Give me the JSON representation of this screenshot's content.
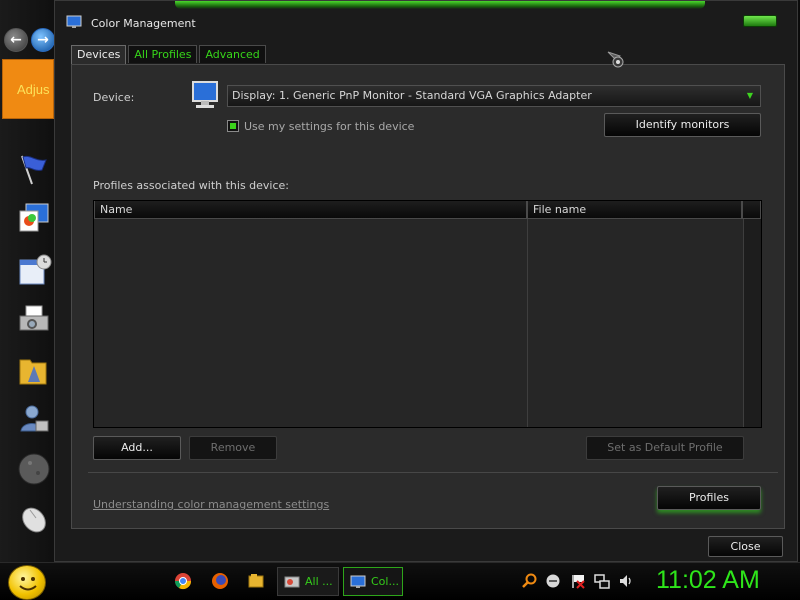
{
  "side_panel": {
    "back_glyph": "←",
    "forward_glyph": "→",
    "tile_text": "Adjus",
    "icons": [
      "flag-icon",
      "display-icon",
      "calendar-icon",
      "printer-icon",
      "folder-icon",
      "user-icon",
      "disc-icon",
      "mouse-icon"
    ]
  },
  "window": {
    "title": "Color Management",
    "tabs": [
      {
        "label": "Devices",
        "active": true
      },
      {
        "label": "All Profiles",
        "active": false
      },
      {
        "label": "Advanced",
        "active": false
      }
    ],
    "device": {
      "label": "Device:",
      "selected": "Display: 1. Generic PnP Monitor - Standard VGA Graphics Adapter",
      "use_my_settings_label": "Use my settings for this device",
      "use_my_settings_checked": true,
      "identify_button": "Identify monitors"
    },
    "profiles": {
      "label": "Profiles associated with this device:",
      "columns": [
        "Name",
        "File name"
      ],
      "rows": []
    },
    "buttons": {
      "add": "Add...",
      "remove": "Remove",
      "set_default": "Set as Default Profile",
      "profiles": "Profiles",
      "close": "Close"
    },
    "link_text": "Understanding color management settings"
  },
  "taskbar": {
    "tasks": [
      {
        "label": "All ...",
        "icon": "control-panel-icon",
        "active": false
      },
      {
        "label": "Col...",
        "icon": "color-management-icon",
        "active": true
      }
    ],
    "pinned": [
      "chrome-icon",
      "firefox-icon",
      "folders-icon"
    ],
    "tray": [
      "search-icon",
      "status-circle-icon",
      "flag-icon",
      "network-icon",
      "volume-icon"
    ],
    "clock": "11:02 AM"
  },
  "colors": {
    "accent_green": "#2ee51a",
    "window_bg": "#1b1b1b",
    "panel_bg": "#2b2b2b",
    "tile_orange": "#f08a12"
  }
}
